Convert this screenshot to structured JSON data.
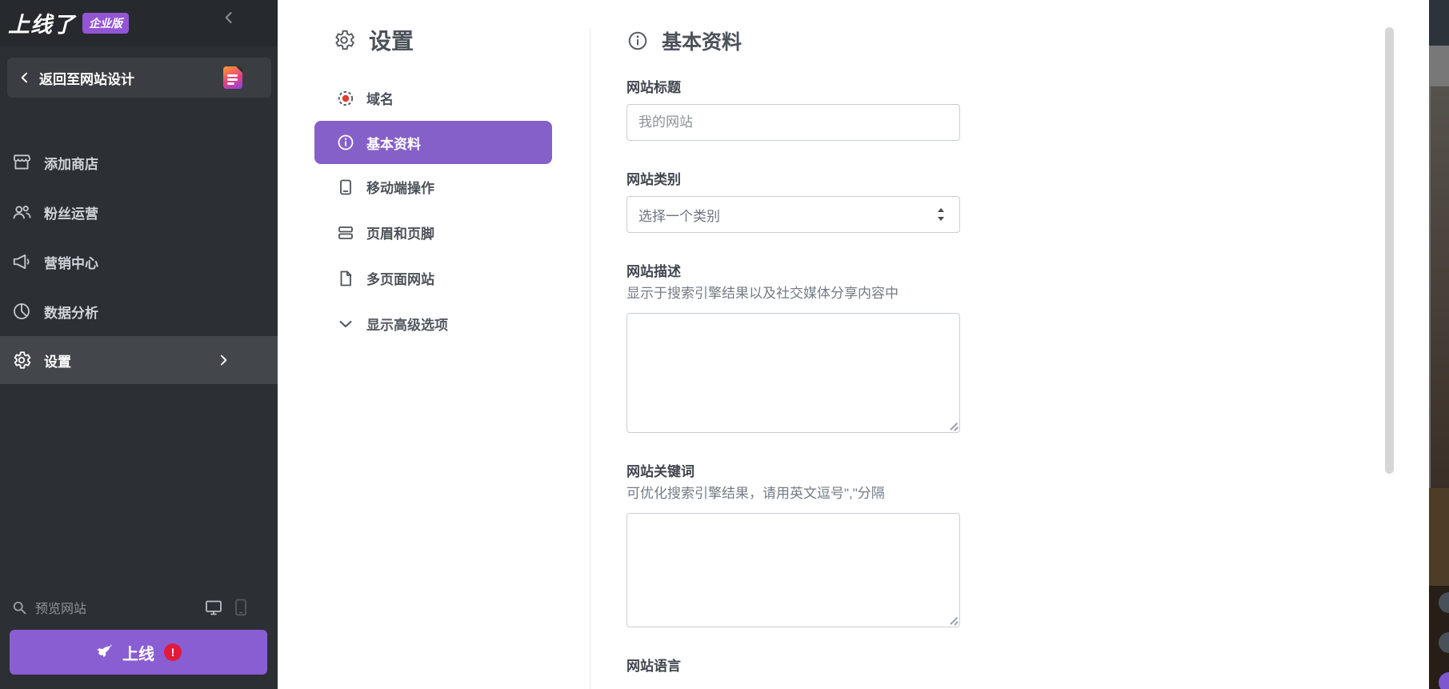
{
  "colors": {
    "accent_purple": "#8660c9",
    "publish_button_purple": "#8a5ed3",
    "plan_badge_purple": "#9355d4",
    "alert_red": "#e11a3c",
    "domain_dot_red": "#e63b2e",
    "sidebar_bg": "#2c2f33"
  },
  "topbar": {
    "logo": "上线了",
    "plan_badge": "企业版",
    "back_label": "返回至网站设计"
  },
  "sidebar": {
    "items": [
      {
        "label": "添加商店"
      },
      {
        "label": "粉丝运营"
      },
      {
        "label": "营销中心"
      },
      {
        "label": "数据分析"
      },
      {
        "label": "设置"
      }
    ],
    "preview_label": "预览网站",
    "publish_label": "上线",
    "publish_alert": "!"
  },
  "settings_menu": {
    "title": "设置",
    "items": [
      {
        "label": "域名"
      },
      {
        "label": "基本资料"
      },
      {
        "label": "移动端操作"
      },
      {
        "label": "页眉和页脚"
      },
      {
        "label": "多页面网站"
      },
      {
        "label": "显示高级选项"
      }
    ]
  },
  "main": {
    "title": "基本资料",
    "site_title": {
      "label": "网站标题",
      "value": "我的网站"
    },
    "site_category": {
      "label": "网站类别",
      "value": "选择一个类别"
    },
    "site_description": {
      "label": "网站描述",
      "hint": "显示于搜索引擎结果以及社交媒体分享内容中",
      "value": ""
    },
    "site_keywords": {
      "label": "网站关键词",
      "hint": "可优化搜索引擎结果，请用英文逗号\",\"分隔",
      "value": ""
    },
    "site_language": {
      "label": "网站语言"
    }
  }
}
